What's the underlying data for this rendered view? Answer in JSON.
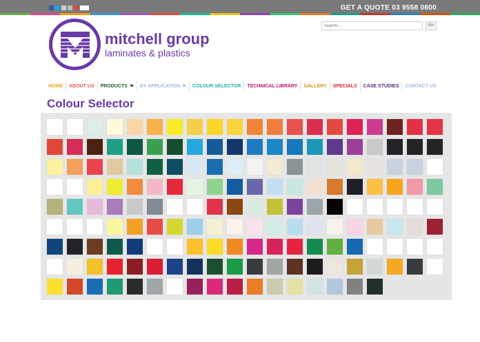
{
  "header": {
    "quote_text": "GET A QUOTE 03 9558 0800",
    "stripe_colors": [
      "#6ab04c",
      "#e84393",
      "#f39c12",
      "#3498db",
      "#9b59b6",
      "#e74c3c",
      "#1abc9c",
      "#f1c40f",
      "#8e44ad",
      "#2ecc71",
      "#e67e22",
      "#16a085",
      "#c0392b",
      "#2980b9",
      "#d35400",
      "#27ae60"
    ],
    "social_icons": [
      {
        "name": "facebook-icon",
        "color": "#3b5998"
      },
      {
        "name": "twitter-icon",
        "color": "#1da1f2"
      },
      {
        "name": "email-icon",
        "color": "#cfcfcf"
      },
      {
        "name": "print-icon",
        "color": "#bdbdbd"
      },
      {
        "name": "google-plus-icon",
        "color": "#dd4b39"
      },
      {
        "name": "share-icon",
        "color": "#ffffff"
      }
    ]
  },
  "logo": {
    "title": "mitchell group",
    "subtitle": "laminates & plastics",
    "color": "#6a3aa6"
  },
  "search": {
    "placeholder": "Search...",
    "button_label": "Go"
  },
  "nav": {
    "items": [
      {
        "label": "HOME",
        "color": "#f1a81c",
        "caret": false
      },
      {
        "label": "ABOUT US",
        "color": "#e85b52",
        "caret": false
      },
      {
        "label": "PRODUCTS",
        "color": "#1a5c2d",
        "caret": true
      },
      {
        "label": "BY APPLICATION",
        "color": "#9fb8d8",
        "caret": true
      },
      {
        "label": "COLOUR SELECTOR",
        "color": "#25b0a9",
        "caret": false
      },
      {
        "label": "TECHNICAL LIBRARY",
        "color": "#c4116b",
        "caret": false
      },
      {
        "label": "GALLERY",
        "color": "#c79a12",
        "caret": false
      },
      {
        "label": "SPECIALS",
        "color": "#d6212f",
        "caret": false
      },
      {
        "label": "CASE STUDIES",
        "color": "#5a2a86",
        "caret": false
      },
      {
        "label": "CONTACT US",
        "color": "#9fb8d8",
        "caret": false
      }
    ]
  },
  "page": {
    "title": "Colour Selector"
  },
  "swatches": [
    [
      "#ffffff",
      "#ffffff",
      "#dbeee6",
      "#fef9d8",
      "#fdd5a6",
      "#f7b24a",
      "#fbea28",
      "#f7ce4a",
      "#fbd52a",
      "#fad43c",
      "#ef8436",
      "#ef7d3f",
      "#e9514e",
      "#dc2e50",
      "#e24941",
      "#dd2254",
      "#cf3b8f",
      "#6d2420",
      "#e23145",
      "#e43447"
    ],
    [
      "#e34638",
      "#d62d58",
      "#4d2110",
      "#1e9f84",
      "#0e5744",
      "#3ba04e",
      "#144e2e",
      "#27a8dc",
      "#155a9a",
      "#12366a",
      "#1d7bc1",
      "#1c87c5",
      "#1878b9",
      "#1b98b9",
      "#5e3a8a",
      "#9b3f97",
      "#c9c9c9",
      "#222227",
      "#242326",
      "#232426"
    ],
    [
      "#fcf19f",
      "#f2a05b",
      "#e9444e",
      "#e3c9a1",
      "#b4e0da",
      "#0e6042",
      "#0f4b62",
      "#d8e9f5",
      "#1a6eb0",
      "#dceef8",
      "#f3f3f3",
      "#f4ebd4",
      "#8a9497",
      "#dfe5e1",
      "#e6e2dc",
      "#f3e8cb",
      "#e8e2de",
      "#c9d2df",
      "#c8d3e2",
      "#ffffff"
    ],
    [
      "#ffffff",
      "#ffffff",
      "#fbef9a",
      "#f0ec32",
      "#f18b3e",
      "#f4b7c5",
      "#e42a3a",
      "#e6f4e7",
      "#8fd28e",
      "#125c9f",
      "#6767ab",
      "#c1dff3",
      "#c7e7e2",
      "#f5e1d1",
      "#d87a2e",
      "#1e1f26",
      "#fcc046",
      "#f6a520",
      "#ef9aa6",
      "#7ec8a1"
    ],
    [
      "#b4b27a",
      "#62c7c2",
      "#e4bbd8",
      "#a97cbc",
      "#c7c9cb",
      "#808b93",
      "#ffffff",
      "#ffffff",
      "#e2314b",
      "#8a4613",
      "#d9ece1",
      "#c1c238",
      "#7c449e",
      "#9aa6ab",
      "#050505",
      "#ffffff",
      "#ffffff",
      "#ffffff",
      "#ffffff",
      "#ffffff"
    ],
    [
      "#ffffff",
      "#ffffff",
      "#ffffff",
      "#faf7a0",
      "#f3a125",
      "#e54d46",
      "#d6d633",
      "#9ccfe9",
      "#f3f0d3",
      "#fdf1e9",
      "#fae2ec",
      "#d4ebe8",
      "#b8ddf1",
      "#dde3ef",
      "#f7f3ec",
      "#f9d4e3",
      "#e8c99e",
      "#c6e7ef",
      "#e4dcd9",
      "#9a2136"
    ],
    [
      "#11447a",
      "#222327",
      "#6b3c1d",
      "#10594a",
      "#113b7b",
      "#ffffff",
      "#ffffff",
      "#fcc02a",
      "#fbdc27",
      "#ef8a21",
      "#d6278b",
      "#d8225b",
      "#e5233f",
      "#148c4f",
      "#63b040",
      "#1668b0",
      "#ffffff",
      "#ffffff",
      "#ffffff",
      "#ffffff"
    ],
    [
      "#ffffff",
      "#f6efe0",
      "#f4c12b",
      "#e4232e",
      "#8d1d24",
      "#d91d33",
      "#1c4389",
      "#15325f",
      "#1d4f2f",
      "#1b9a47",
      "#383b3c",
      "#a3a5a3",
      "#5c3321",
      "#1d1c1b",
      "#ebe7dc",
      "#c6a338",
      "#d3d8d5",
      "#f4a924",
      "#3a3b3f",
      "#ffffff"
    ],
    [
      "#fde02f",
      "#d3482b",
      "#1a6cb5",
      "#1f9a73",
      "#2b2b2b",
      "#9ea7ac",
      "#ffffff",
      "#96215f",
      "#dc2a79",
      "#b81f45",
      "#ea7d25",
      "#cbcbb2",
      "#e4e2a2",
      "#d2e2e5",
      "#b1c7e0",
      "#7f8280",
      "#22302b"
    ]
  ]
}
